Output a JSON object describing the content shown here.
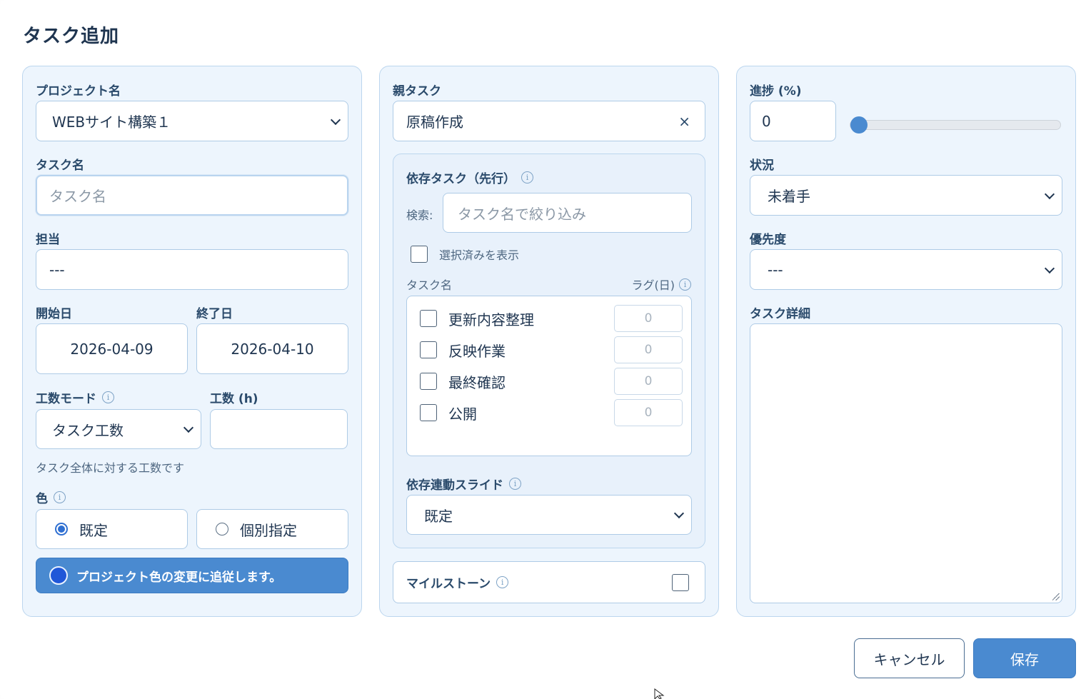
{
  "dialog": {
    "title": "タスク追加"
  },
  "left": {
    "project_label": "プロジェクト名",
    "project_value": "WEBサイト構築１",
    "task_name_label": "タスク名",
    "task_name_placeholder": "タスク名",
    "assignee_label": "担当",
    "assignee_value": "---",
    "start_label": "開始日",
    "start_value": "2026-04-09",
    "end_label": "終了日",
    "end_value": "2026-04-10",
    "effort_mode_label": "工数モード",
    "effort_mode_value": "タスク工数",
    "effort_label": "工数 (h)",
    "effort_value": "",
    "effort_hint": "タスク全体に対する工数です",
    "color_label": "色",
    "color_options": [
      "既定",
      "個別指定"
    ],
    "color_selected": "既定",
    "follow_text": "プロジェクト色の変更に追従します。",
    "swatch_color": "#2057d8"
  },
  "middle": {
    "parent_label": "親タスク",
    "parent_value": "原稿作成",
    "clear_symbol": "×",
    "deps_label": "依存タスク（先行）",
    "search_label": "検索:",
    "search_placeholder": "タスク名で絞り込み",
    "show_selected_label": "選択済みを表示",
    "col_task": "タスク名",
    "col_lag": "ラグ(日)",
    "tasks": [
      {
        "name": "更新内容整理",
        "lag": "0",
        "checked": false
      },
      {
        "name": "反映作業",
        "lag": "0",
        "checked": false
      },
      {
        "name": "最終確認",
        "lag": "0",
        "checked": false
      },
      {
        "name": "公開",
        "lag": "0",
        "checked": false
      }
    ],
    "slide_label": "依存連動スライド",
    "slide_value": "既定",
    "milestone_label": "マイルストーン"
  },
  "right": {
    "progress_label": "進捗 (%)",
    "progress_value": "0",
    "progress_fraction": 0,
    "status_label": "状況",
    "status_value": "未着手",
    "priority_label": "優先度",
    "priority_value": "---",
    "detail_label": "タスク詳細",
    "detail_value": ""
  },
  "footer": {
    "cancel_label": "キャンセル",
    "save_label": "保存"
  },
  "colors": {
    "accent": "#4a8ad0",
    "panel_bg": "#edf5fd",
    "text": "#1f3550"
  }
}
